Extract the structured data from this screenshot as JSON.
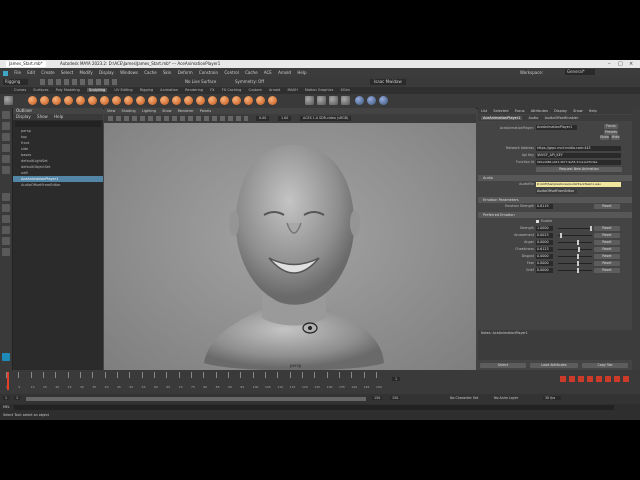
{
  "window": {
    "tab": "James_Start.mb*",
    "title": "Autodesk MAYA 2023.2: D:\\ACE\\James\\James_Start.mb* --- AceAnimationPlayer1"
  },
  "menubar": [
    "File",
    "Edit",
    "Create",
    "Select",
    "Modify",
    "Display",
    "Windows",
    "Cache",
    "Skin",
    "Deform",
    "Constrain",
    "Control",
    "Cache",
    "ACE",
    "Arnold",
    "Help"
  ],
  "workspace": {
    "label": "Workspace:",
    "value": "General*"
  },
  "statusline": {
    "mode": "Rigging",
    "no_live": "No Live Surface",
    "symmetry": "Symmetry: Off",
    "user": "Isaac Mwidaw"
  },
  "shelf_tabs": [
    "Curves",
    "Surfaces",
    "Poly Modeling",
    "Sculpting",
    "UV Editing",
    "Rigging",
    "Animation",
    "Rendering",
    "FX",
    "FX Caching",
    "Custom",
    "Arnold",
    "MASH",
    "Motion Graphics",
    "XGen"
  ],
  "shelf_active": "Sculpting",
  "outliner": {
    "title": "Outliner",
    "menu": [
      "Display",
      "Show",
      "Help"
    ],
    "items": [
      "persp",
      "top",
      "front",
      "side",
      "bases",
      "defaultLightSet",
      "defaultObjectSet",
      "ueft",
      "AceAnimationPlayer1",
      "AudioOffsetFromEditor"
    ],
    "selected": "AceAnimationPlayer1"
  },
  "viewport": {
    "menu": [
      "View",
      "Shading",
      "Lighting",
      "Show",
      "Renderer",
      "Panels"
    ],
    "camera_label": "persp",
    "values": {
      "frame": "0.00",
      "scale": "1.00",
      "colorspace": "ACES 1.0 SDR-video (sRGB)"
    }
  },
  "attribute_editor": {
    "tabs": [
      "List",
      "Selected",
      "Focus",
      "Attributes",
      "Display",
      "Show",
      "Help"
    ],
    "node_tabs": [
      "AceAnimationPlayer1",
      "Audio",
      "AudioOffsetEnabler"
    ],
    "node_label": "AceAnimationPlayer:",
    "node_value": "AceAnimationPlayer1",
    "focus": "Focus",
    "presets": "Presets",
    "show": "Show",
    "hide": "Hide",
    "network_label": "Network Address",
    "network_value": "https://grpc.nvcf.nvidia.com:443",
    "apikey_label": "Api Key",
    "apikey_value": "$NVCF_API_KEY",
    "function_label": "Function Id",
    "function_value": "945ed088-a023-4677-9a55-31ca1e07b4ba",
    "request_button": "Request New Animation",
    "audio_section": "Audio",
    "audiofile_label": "AudioFile",
    "audiofile_value": "D:/ACE/SampleVoices/AudioTrackTeam1.wav",
    "audio_node": "AudioOffsetFromEditor",
    "emotion_section": "Emotion Parameters",
    "emotion_label": "Emotion Strength",
    "emotion_value": "0.8119",
    "reset": "Reset",
    "preferred_section": "Preferred Emotion",
    "enable": "Enable",
    "emotions": [
      {
        "name": "Strength",
        "value": "1.0000",
        "level": 1.0
      },
      {
        "name": "Amazement",
        "value": "0.0023",
        "level": 0.05
      },
      {
        "name": "Anger",
        "value": "0.0000",
        "level": 0.6
      },
      {
        "name": "Cheekiness",
        "value": "0.6123",
        "level": 0.61
      },
      {
        "name": "Disgust",
        "value": "0.0000",
        "level": 0.6
      },
      {
        "name": "Fear",
        "value": "0.0000",
        "level": 0.6
      },
      {
        "name": "Grief",
        "value": "0.0000",
        "level": 0.6
      }
    ],
    "notes_label": "Notes: AceAnimationPlayer1",
    "select_btn": "Select",
    "load_btn": "Load Attributes",
    "copy_btn": "Copy Tab"
  },
  "timeline": {
    "ticks": [
      "1",
      "5",
      "10",
      "15",
      "20",
      "25",
      "30",
      "35",
      "40",
      "45",
      "50",
      "55",
      "60",
      "65",
      "70",
      "75",
      "80",
      "85",
      "90",
      "95",
      "100",
      "105",
      "110",
      "115",
      "120",
      "125",
      "130",
      "135",
      "140",
      "145",
      "150"
    ],
    "current": "1"
  },
  "range": {
    "start": "1",
    "start2": "1",
    "end": "150",
    "end2": "150",
    "character": "No Character Set",
    "anim_layer": "No Anim Layer",
    "fps": "30 fps"
  },
  "command": {
    "lang": "MEL",
    "help": "Select Tool: select an object"
  },
  "colors": {
    "accent": "#5285a6",
    "highlight": "#f0e6a0",
    "timeline_marker": "#e0402a"
  }
}
